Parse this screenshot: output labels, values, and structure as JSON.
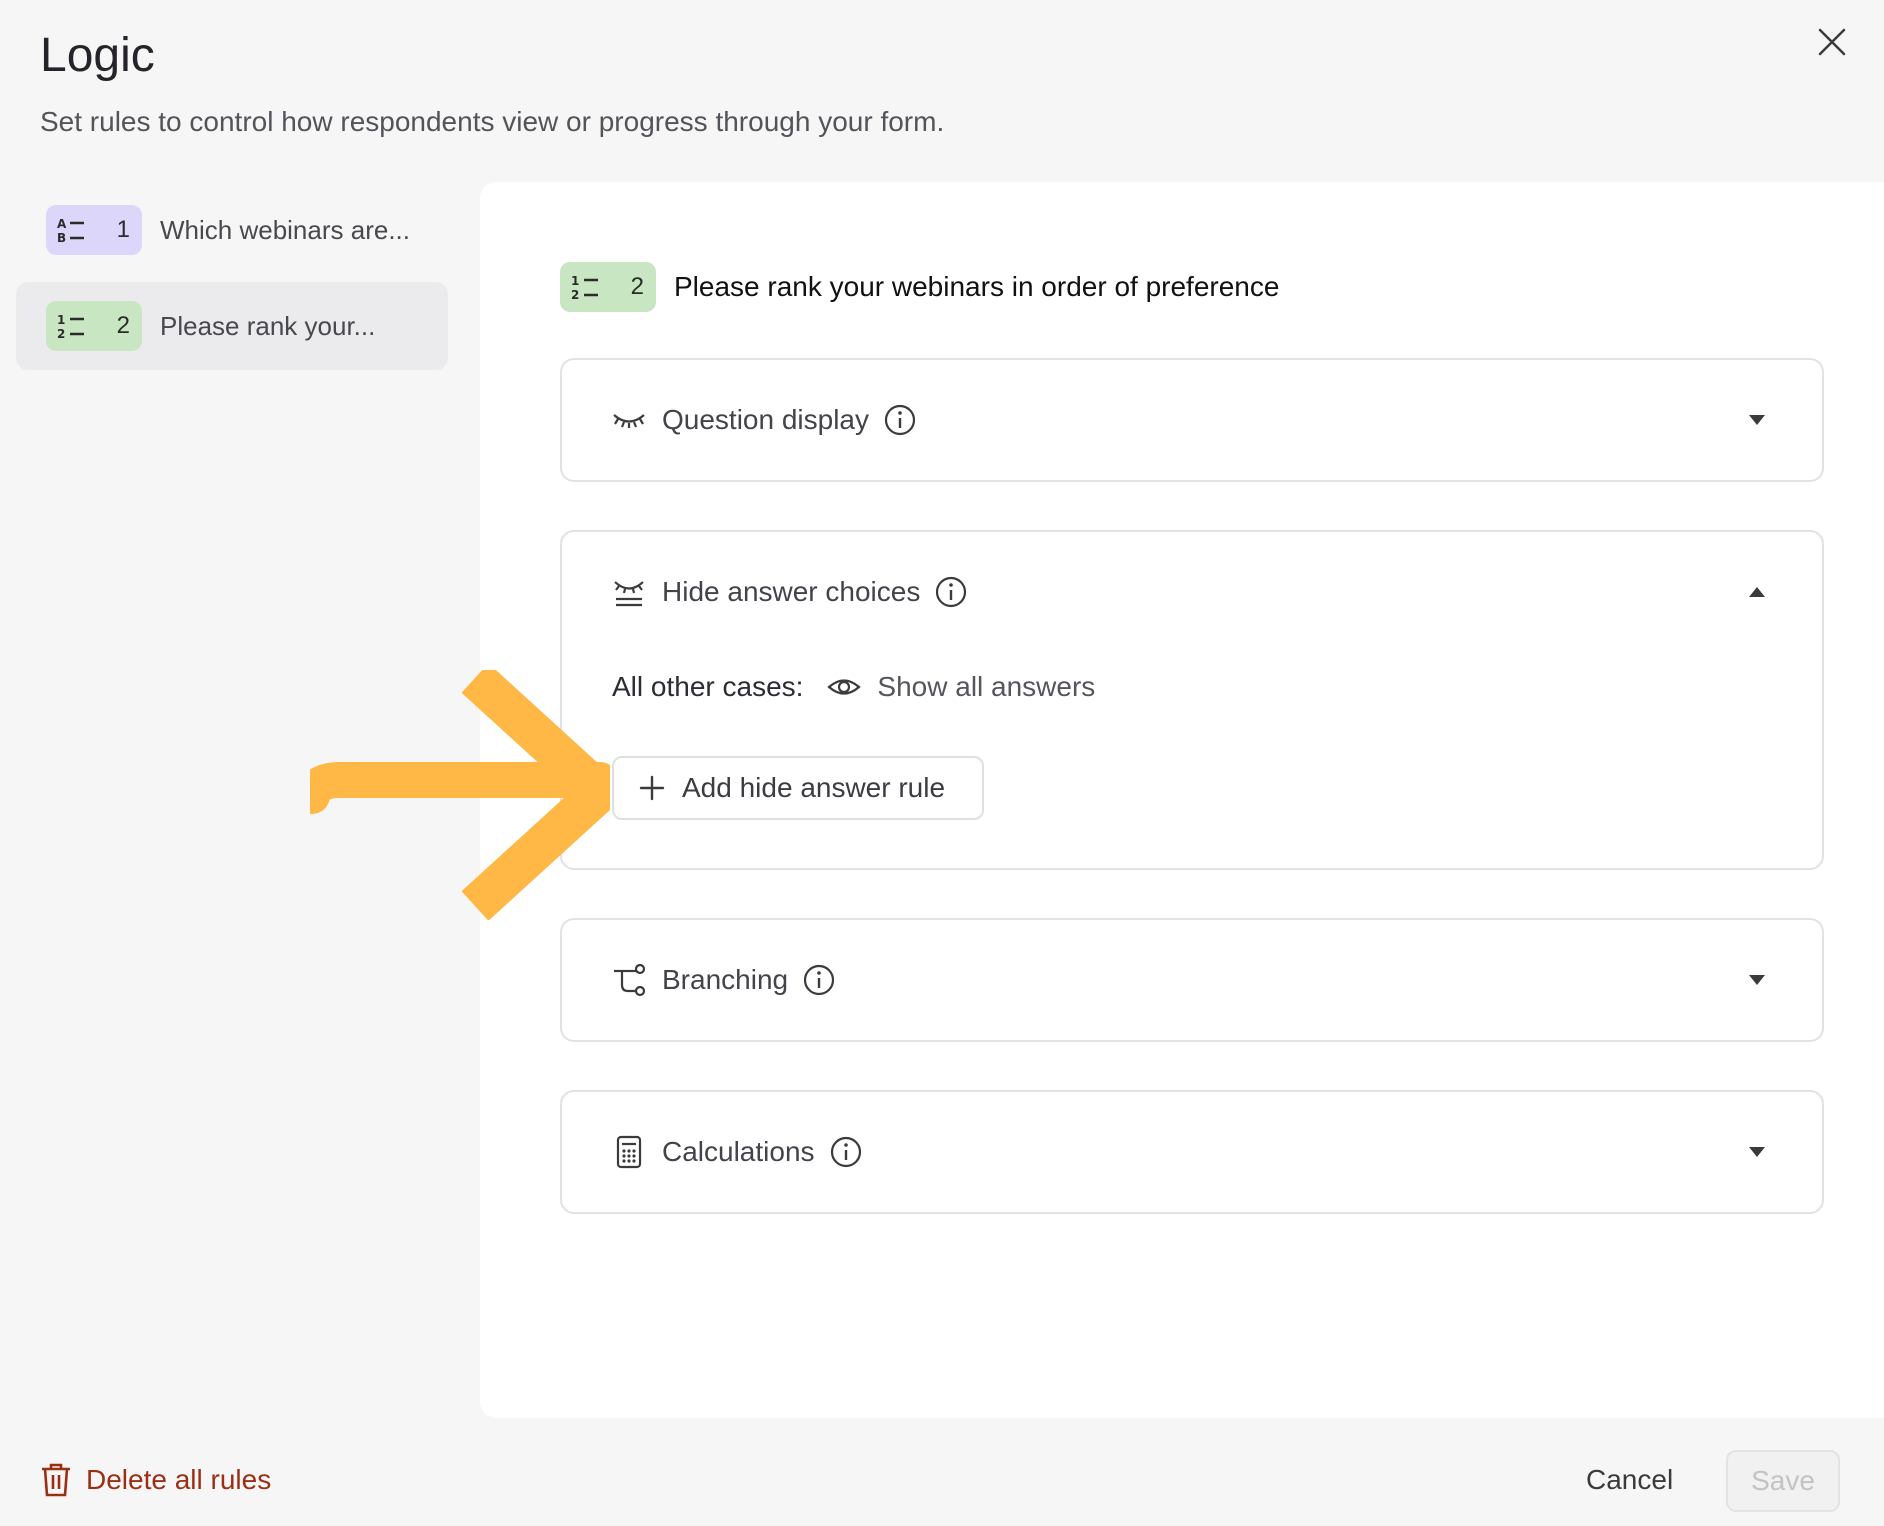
{
  "dialog": {
    "title": "Logic",
    "subtitle": "Set rules to control how respondents view or progress through your form."
  },
  "sidebar": {
    "items": [
      {
        "number": "1",
        "label": "Which webinars are...",
        "icon": "multiple-choice-icon",
        "badge_color": "#dcd6fb"
      },
      {
        "number": "2",
        "label": "Please rank your...",
        "icon": "ranking-icon",
        "badge_color": "#c9e6c3",
        "active": true
      }
    ]
  },
  "question": {
    "number": "2",
    "title": "Please rank your webinars in order of preference"
  },
  "sections": {
    "question_display": {
      "label": "Question display",
      "expanded": false
    },
    "hide_answer_choices": {
      "label": "Hide answer choices",
      "expanded": true,
      "other_cases_label": "All other cases:",
      "other_cases_value": "Show all answers",
      "add_rule_label": "Add hide answer rule"
    },
    "branching": {
      "label": "Branching",
      "expanded": false
    },
    "calculations": {
      "label": "Calculations",
      "expanded": false
    }
  },
  "footer": {
    "delete_label": "Delete all rules",
    "cancel_label": "Cancel",
    "save_label": "Save"
  },
  "colors": {
    "accent_arrow": "#ffb845",
    "delete_red": "#9b2f14"
  }
}
